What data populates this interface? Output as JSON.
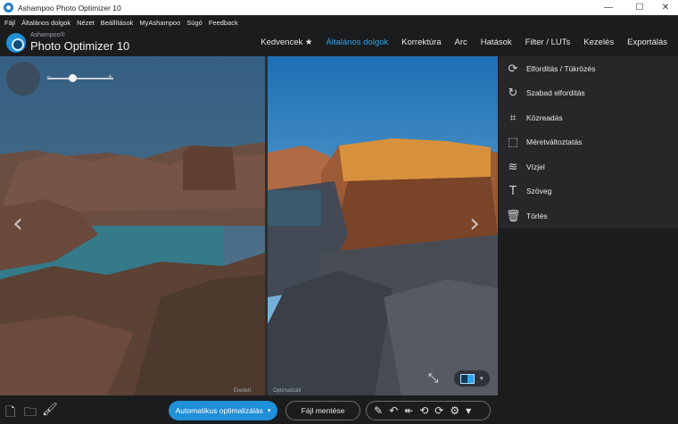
{
  "window": {
    "title": "Ashampoo Photo Optimizer 10",
    "minimize": "—",
    "maximize": "☐",
    "close": "✕"
  },
  "menu": [
    "Fájl",
    "Általános dolgok",
    "Nézet",
    "Beállítások",
    "MyAshampoo",
    "Súgó",
    "Feedback"
  ],
  "brand": {
    "line1": "Ashampoo®",
    "line2": "Photo Optimizer 10"
  },
  "nav": {
    "items": [
      "Kedvencek ★",
      "Általános dolgok",
      "Korrektúra",
      "Arc",
      "Hatások",
      "Filter / LUTs",
      "Kezelés",
      "Exportálás"
    ],
    "active_index": 1,
    "accent": "#2ea4ec"
  },
  "viewer": {
    "zoom_minus": "–",
    "zoom_plus": "+",
    "prev_arrow": "‹",
    "next_arrow": "›",
    "label_original": "Eredeti",
    "label_optimized": "Optimalizált",
    "shrink_icon": "shrink-icon"
  },
  "panel": {
    "items": [
      {
        "label": "Elforditás / Tükrözés",
        "icon": "⟳"
      },
      {
        "label": "Szabad elforditás",
        "icon": "↻"
      },
      {
        "label": "Közreadás",
        "icon": "⌗"
      },
      {
        "label": "Méretváltoztatás",
        "icon": "⬚"
      },
      {
        "label": "Vízjel",
        "icon": "≋"
      },
      {
        "label": "Szöveg",
        "icon": "T"
      },
      {
        "label": "Törlés",
        "icon": "🗑"
      }
    ]
  },
  "bottom": {
    "auto_label": "Automatikus optimalizálás",
    "auto_caret": "▾",
    "save_label": "Fájl mentése",
    "tools": [
      "✎",
      "↶",
      "↞",
      "⟲",
      "⟳",
      "⚙",
      "▾"
    ]
  }
}
